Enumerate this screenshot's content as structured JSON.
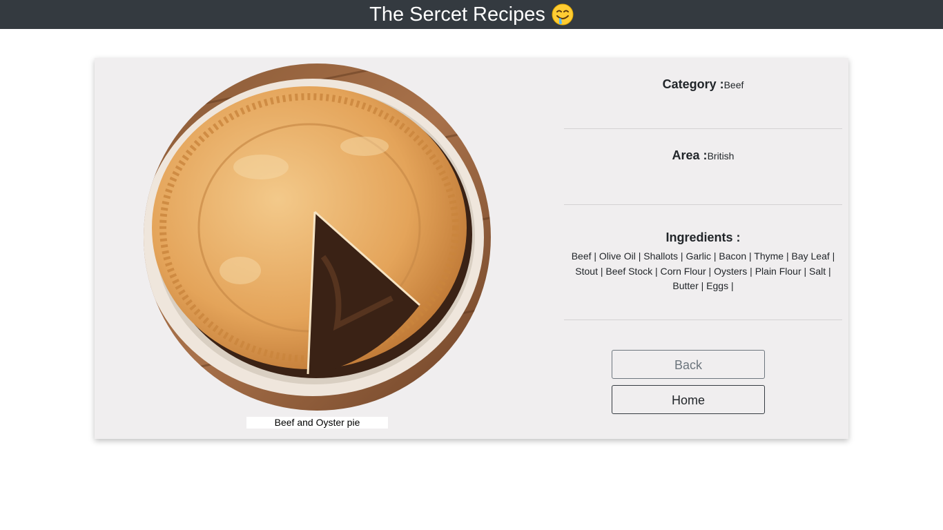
{
  "header": {
    "title": "The Sercet Recipes",
    "emoji_icon": "drooling-face-icon"
  },
  "recipe": {
    "name": "Beef and Oyster pie",
    "category_label": "Category :",
    "category_value": "Beef",
    "area_label": "Area :",
    "area_value": "British",
    "ingredients_label": "Ingredients :",
    "ingredients": [
      "Beef",
      "Olive Oil",
      "Shallots",
      "Garlic",
      "Bacon",
      "Thyme",
      "Bay Leaf",
      "Stout",
      "Beef Stock",
      "Corn Flour",
      "Oysters",
      "Plain Flour",
      "Salt",
      "Butter",
      "Eggs"
    ],
    "ingredients_text": "Beef | Olive Oil | Shallots | Garlic | Bacon | Thyme | Bay Leaf | Stout | Beef Stock | Corn Flour | Oysters | Plain Flour | Salt | Butter | Eggs |"
  },
  "buttons": {
    "back_label": "Back",
    "home_label": "Home"
  },
  "colors": {
    "navbar": "#343a40",
    "card_bg": "#f0eeef",
    "crust": "#e2a55a",
    "filling": "#3a2215"
  }
}
